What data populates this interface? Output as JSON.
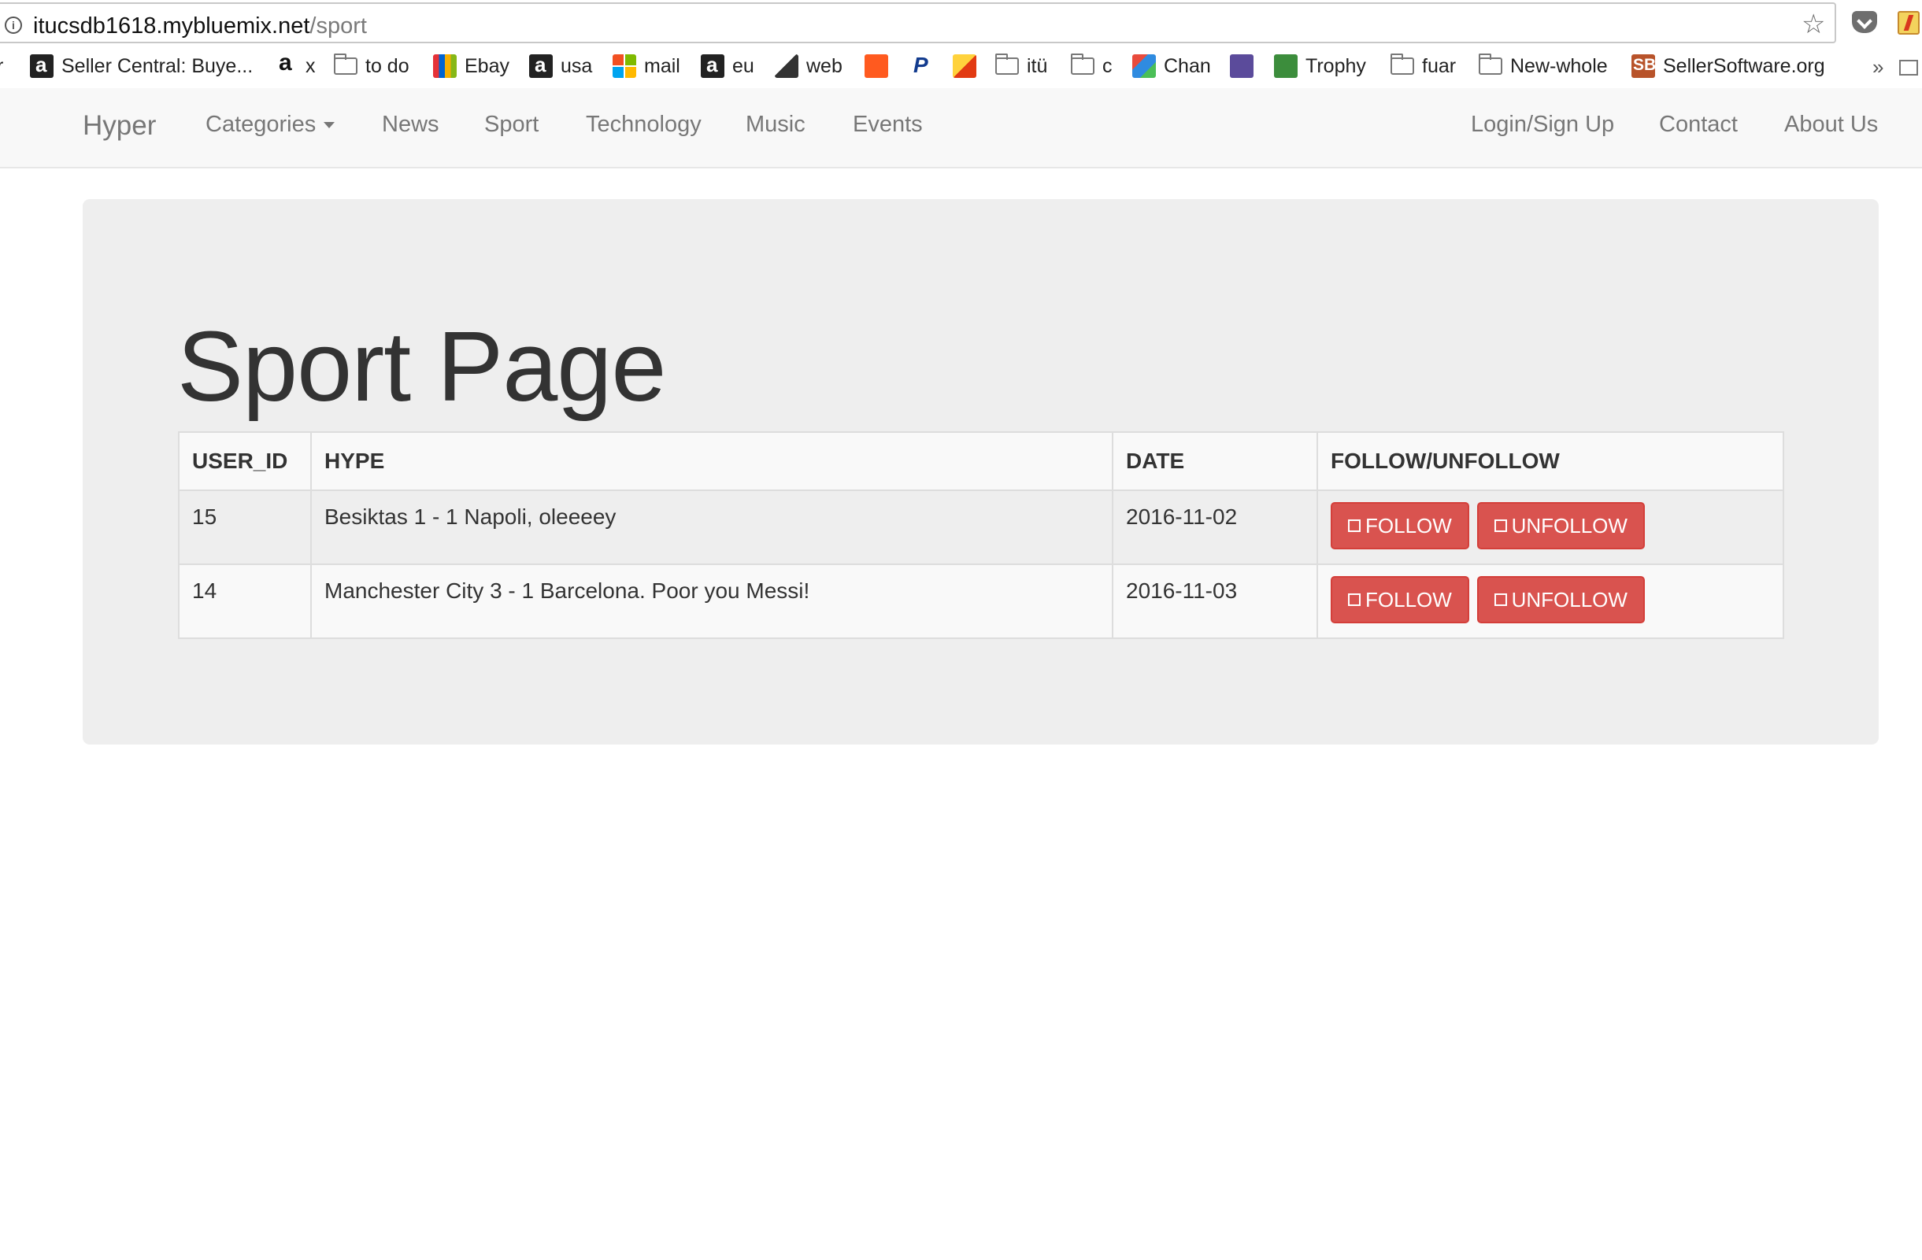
{
  "browser": {
    "url_host": "itucsdb1618.mybluemix.net",
    "url_path": "/sport",
    "bookmarks": [
      {
        "label": "r",
        "icon": "generic-icon"
      },
      {
        "label": "Seller Central: Buye...",
        "icon": "amazon-icon"
      },
      {
        "label": "x",
        "icon": "amazon-icon"
      },
      {
        "label": "to do",
        "icon": "folder-icon"
      },
      {
        "label": "Ebay",
        "icon": "ebay-icon"
      },
      {
        "label": "usa",
        "icon": "amazon-icon"
      },
      {
        "label": "mail",
        "icon": "microsoft-icon"
      },
      {
        "label": "eu",
        "icon": "amazon-icon"
      },
      {
        "label": "web",
        "icon": "web-icon"
      },
      {
        "label": "",
        "icon": "orange-icon"
      },
      {
        "label": "",
        "icon": "paypal-icon"
      },
      {
        "label": "",
        "icon": "yellow-icon"
      },
      {
        "label": "itü",
        "icon": "folder-icon"
      },
      {
        "label": "c",
        "icon": "folder-icon"
      },
      {
        "label": "Chan",
        "icon": "chan-icon"
      },
      {
        "label": "",
        "icon": "play-icon"
      },
      {
        "label": "Trophy",
        "icon": "trophy-icon"
      },
      {
        "label": "fuar",
        "icon": "folder-icon"
      },
      {
        "label": "New-whole",
        "icon": "folder-icon"
      },
      {
        "label": "SellerSoftware.org",
        "icon": "sb-icon"
      }
    ],
    "overflow": "»"
  },
  "navbar": {
    "brand": "Hyper",
    "left_items": [
      "Categories",
      "News",
      "Sport",
      "Technology",
      "Music",
      "Events"
    ],
    "right_items": [
      "Login/Sign Up",
      "Contact",
      "About Us"
    ]
  },
  "main": {
    "title": "Sport Page",
    "table": {
      "headers": [
        "USER_ID",
        "HYPE",
        "DATE",
        "FOLLOW/UNFOLLOW"
      ],
      "rows": [
        {
          "user_id": "15",
          "hype": "Besiktas 1 - 1 Napoli, oleeeey",
          "date": "2016-11-02"
        },
        {
          "user_id": "14",
          "hype": "Manchester City 3 - 1 Barcelona. Poor you Messi!",
          "date": "2016-11-03"
        }
      ],
      "follow_label": "FOLLOW",
      "unfollow_label": "UNFOLLOW"
    }
  },
  "colors": {
    "danger": "#d9534f",
    "navbar_bg": "#f8f8f8",
    "jumbotron_bg": "#eeeeee"
  }
}
